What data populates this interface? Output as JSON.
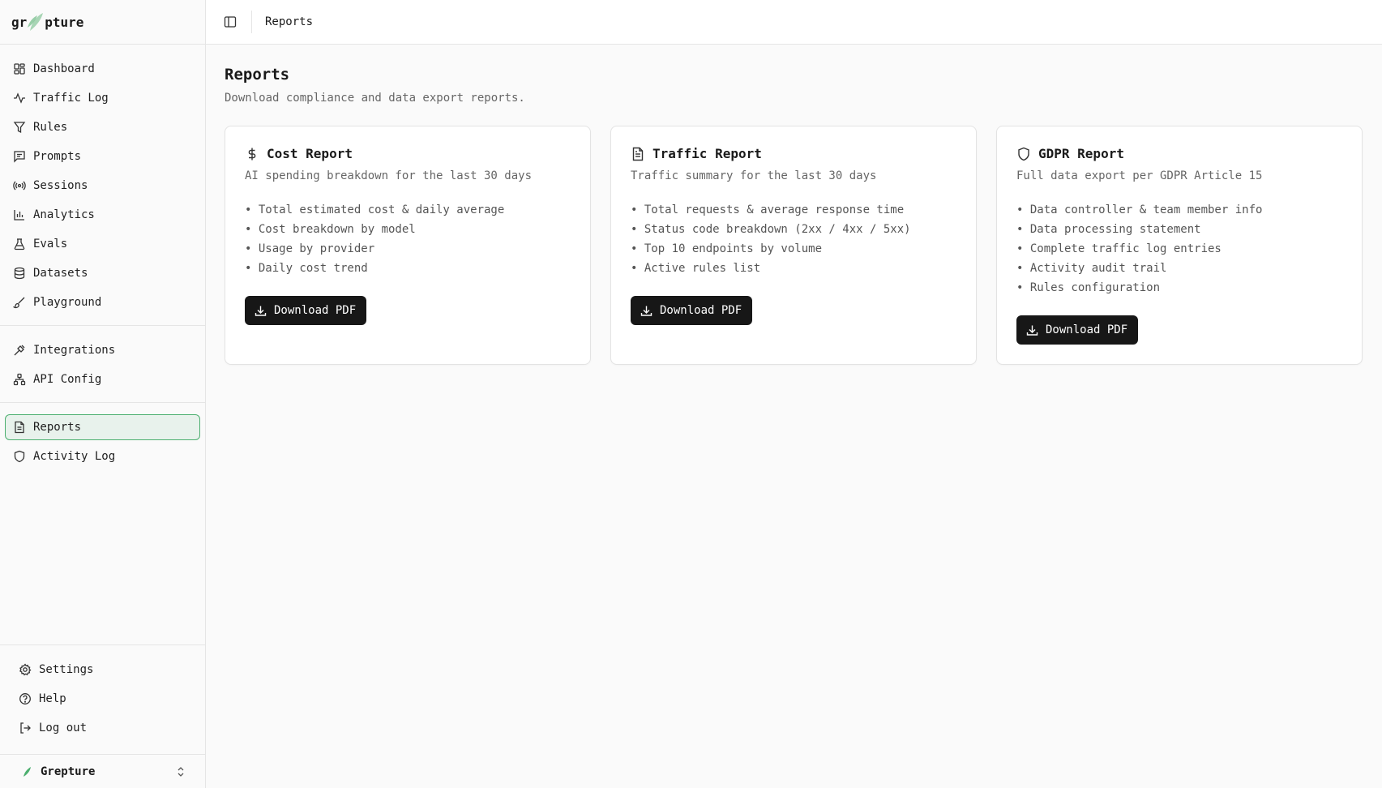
{
  "brand": {
    "name_left": "gr",
    "name_right": "pture",
    "accent": "#4caf6f"
  },
  "sidebar": {
    "primary": [
      {
        "label": "Dashboard",
        "icon": "dashboard-icon"
      },
      {
        "label": "Traffic Log",
        "icon": "activity-icon"
      },
      {
        "label": "Rules",
        "icon": "filter-icon"
      },
      {
        "label": "Prompts",
        "icon": "message-icon"
      },
      {
        "label": "Sessions",
        "icon": "radio-icon"
      },
      {
        "label": "Analytics",
        "icon": "bar-chart-icon"
      },
      {
        "label": "Evals",
        "icon": "flask-icon"
      },
      {
        "label": "Datasets",
        "icon": "database-icon"
      },
      {
        "label": "Playground",
        "icon": "brush-icon"
      }
    ],
    "secondary": [
      {
        "label": "Integrations",
        "icon": "plug-icon"
      },
      {
        "label": "API Config",
        "icon": "network-icon"
      }
    ],
    "tertiary": [
      {
        "label": "Reports",
        "icon": "file-text-icon",
        "active": true
      },
      {
        "label": "Activity Log",
        "icon": "shield-icon"
      }
    ],
    "bottom": [
      {
        "label": "Settings",
        "icon": "gear-icon"
      },
      {
        "label": "Help",
        "icon": "help-circle-icon"
      },
      {
        "label": "Log out",
        "icon": "logout-icon"
      }
    ],
    "org_name": "Grepture"
  },
  "topbar": {
    "breadcrumb": "Reports"
  },
  "page": {
    "title": "Reports",
    "subtitle": "Download compliance and data export reports."
  },
  "cards": [
    {
      "title": "Cost Report",
      "icon": "dollar-icon",
      "description": "AI spending breakdown for the last 30 days",
      "items": [
        "Total estimated cost & daily average",
        "Cost breakdown by model",
        "Usage by provider",
        "Daily cost trend"
      ],
      "button": "Download PDF"
    },
    {
      "title": "Traffic Report",
      "icon": "file-text-icon",
      "description": "Traffic summary for the last 30 days",
      "items": [
        "Total requests & average response time",
        "Status code breakdown (2xx / 4xx / 5xx)",
        "Top 10 endpoints by volume",
        "Active rules list"
      ],
      "button": "Download PDF"
    },
    {
      "title": "GDPR Report",
      "icon": "shield-icon",
      "description": "Full data export per GDPR Article 15",
      "items": [
        "Data controller & team member info",
        "Data processing statement",
        "Complete traffic log entries",
        "Activity audit trail",
        "Rules configuration"
      ],
      "button": "Download PDF"
    }
  ]
}
